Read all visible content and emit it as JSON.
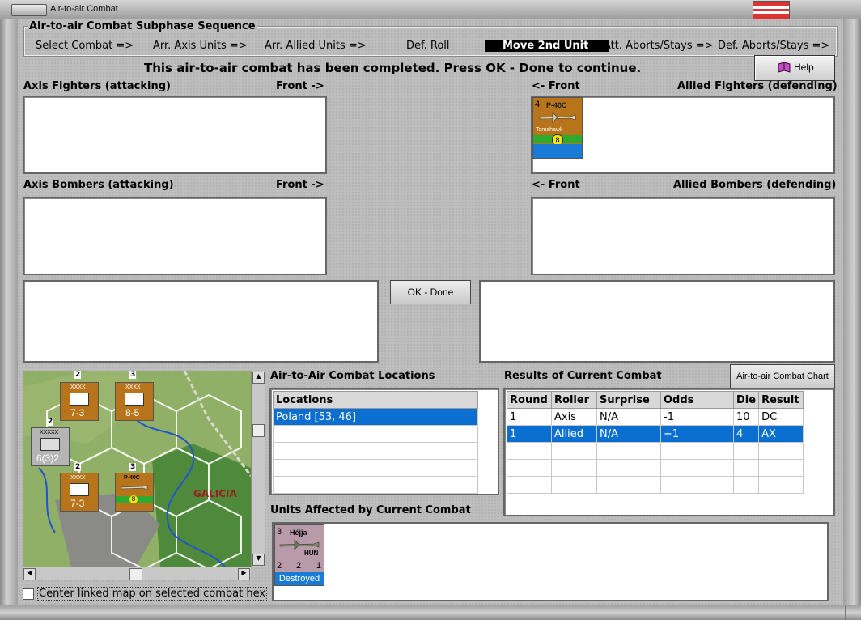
{
  "window": {
    "title": "Air-to-air Combat"
  },
  "sequence": {
    "title": "Air-to-air Combat Subphase Sequence",
    "steps": [
      "Select Combat =>",
      "Arr. Axis Units =>",
      "Arr. Allied Units =>",
      "Def. Roll",
      "Move 2nd Unit",
      "Att. Aborts/Stays =>",
      "Def. Aborts/Stays =>"
    ],
    "active_index": 4
  },
  "message": "This air-to-air combat has been completed.  Press OK - Done to continue.",
  "help_label": "Help",
  "labels": {
    "axis_fighters": "Axis Fighters (attacking)",
    "front_right": "Front ->",
    "front_left": "<- Front",
    "allied_fighters": "Allied Fighters (defending)",
    "axis_bombers": "Axis Bombers (attacking)",
    "allied_bombers": "Allied Bombers (defending)",
    "locations_title": "Air-to-Air Combat Locations",
    "results_title": "Results of Current Combat",
    "affected_title": "Units Affected by Current Combat"
  },
  "ok_button": "OK - Done",
  "chart_button": "Air-to-air Combat Chart",
  "allied_fighter_unit": {
    "type": "P-40C",
    "name": "Tomahawk",
    "left_num": "4",
    "bottom_num": "8"
  },
  "locations": {
    "header": "Locations",
    "rows": [
      "Poland [53, 46]",
      "",
      "",
      "",
      ""
    ],
    "selected": 0
  },
  "results": {
    "headers": [
      "Round",
      "Roller",
      "Surprise",
      "Odds",
      "Die",
      "Result"
    ],
    "rows": [
      [
        "1",
        "Axis",
        "N/A",
        "-1",
        "10",
        "DC"
      ],
      [
        "1",
        "Allied",
        "N/A",
        "+1",
        "4",
        "AX"
      ],
      [
        "",
        "",
        "",
        "",
        "",
        ""
      ],
      [
        "",
        "",
        "",
        "",
        "",
        ""
      ],
      [
        "",
        "",
        "",
        "",
        "",
        ""
      ]
    ],
    "selected": 1
  },
  "affected_unit": {
    "name": "Héjja",
    "nation": "HUN",
    "top_num": "3",
    "bl": "2",
    "bm": "2",
    "br": "1",
    "status": "Destroyed"
  },
  "map": {
    "region_label": "GALICIA",
    "counters": [
      {
        "kind": "XXXX",
        "value": "7-3",
        "stack": "2"
      },
      {
        "kind": "XXXX",
        "value": "8-5",
        "stack": "3"
      },
      {
        "kind": "XXXXX",
        "value": "6(3)2",
        "stack": "2"
      },
      {
        "kind": "XXXX",
        "value": "7-3",
        "stack": "2"
      },
      {
        "kind": "P-40C",
        "value": "8",
        "stack": "3"
      }
    ]
  },
  "center_checkbox": {
    "label": "Center linked map on selected combat hex",
    "checked": false
  },
  "colors": {
    "selection": "#0a6fd0",
    "counter_brown": "#b8741a",
    "counter_green": "#2faa2f",
    "allied_blue": "#1a7bd6"
  }
}
